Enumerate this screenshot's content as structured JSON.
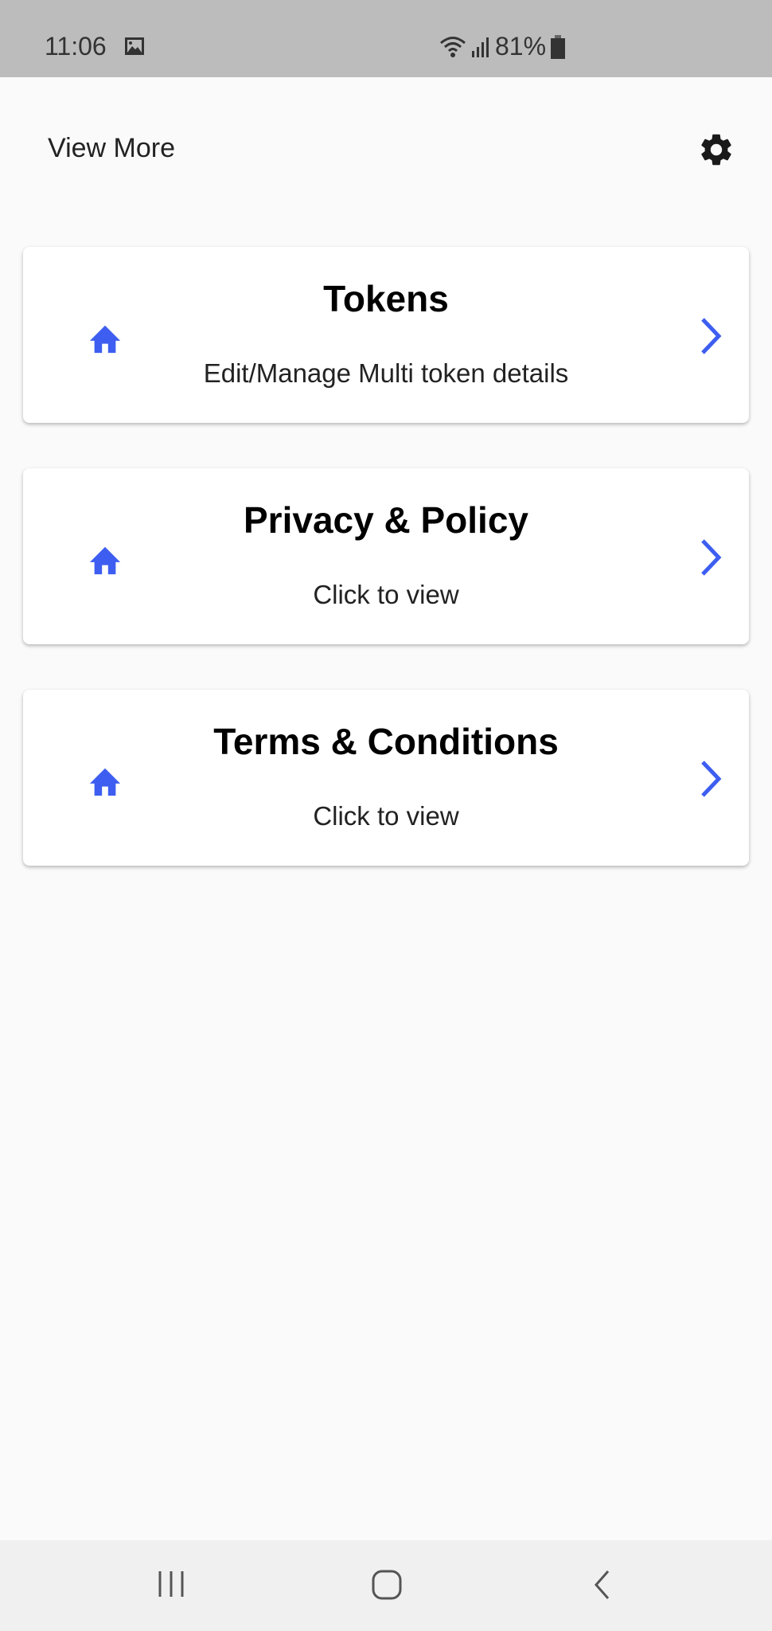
{
  "status_bar": {
    "time": "11:06",
    "battery": "81%"
  },
  "header": {
    "title": "View More",
    "settings_icon": "gear-icon"
  },
  "accent_color": "#3d5ef0",
  "cards": [
    {
      "title": "Tokens",
      "subtitle": "Edit/Manage Multi token details",
      "icon": "home-icon"
    },
    {
      "title": "Privacy & Policy",
      "subtitle": "Click to view",
      "icon": "home-icon"
    },
    {
      "title": "Terms & Conditions",
      "subtitle": "Click to view",
      "icon": "home-icon"
    }
  ],
  "nav_bar": {
    "buttons": [
      "recent-apps",
      "home",
      "back"
    ]
  }
}
